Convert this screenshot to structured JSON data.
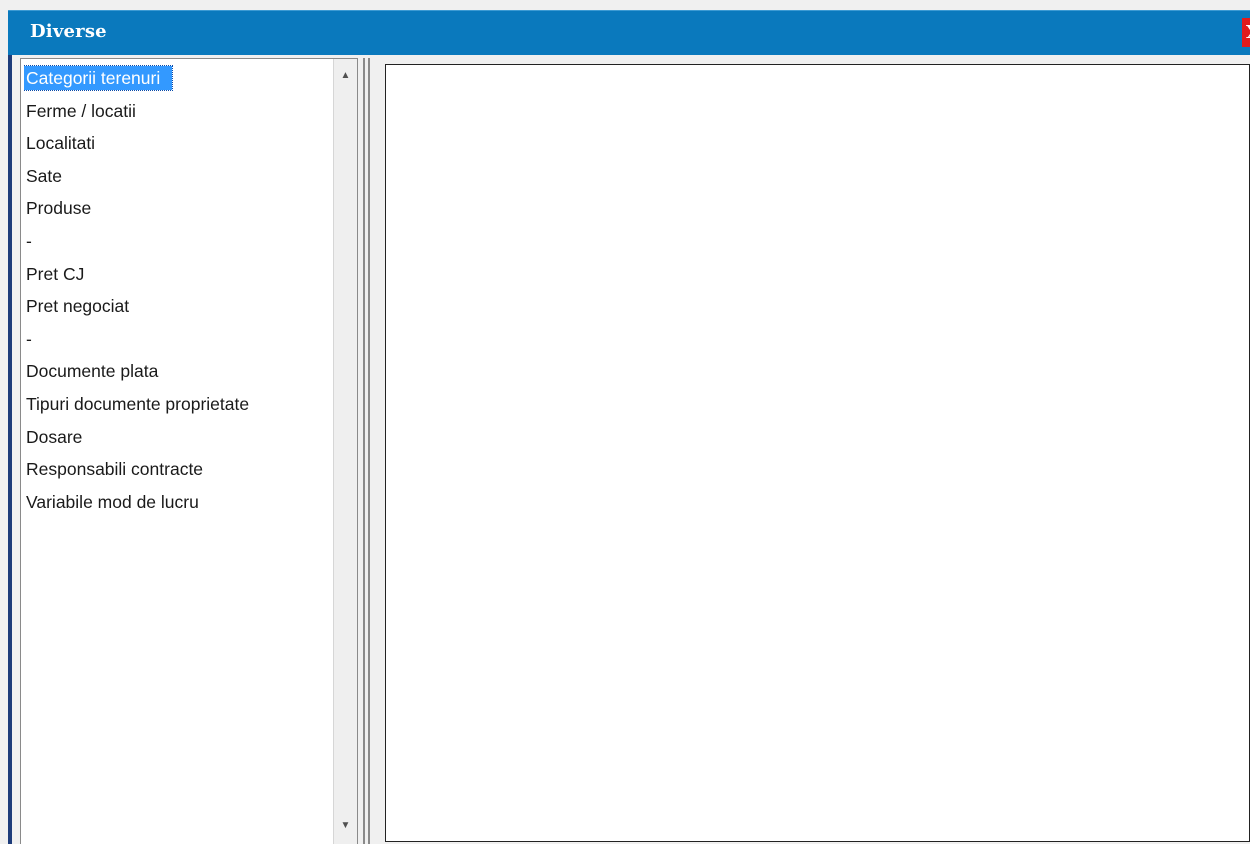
{
  "window": {
    "title": "Diverse",
    "close_label": "X",
    "accent_color": "#0a79bd",
    "close_color": "#e21b1b"
  },
  "list": {
    "selected_index": 0,
    "items": [
      {
        "label": "Categorii terenuri"
      },
      {
        "label": "Ferme / locatii"
      },
      {
        "label": "Localitati"
      },
      {
        "label": "Sate"
      },
      {
        "label": "Produse"
      },
      {
        "label": "-"
      },
      {
        "label": "Pret CJ"
      },
      {
        "label": "Pret negociat"
      },
      {
        "label": "-"
      },
      {
        "label": "Documente plata"
      },
      {
        "label": "Tipuri documente proprietate"
      },
      {
        "label": "Dosare"
      },
      {
        "label": "Responsabili contracte"
      },
      {
        "label": "Variabile mod de lucru"
      }
    ]
  },
  "scrollbar": {
    "up_icon": "scroll-up-arrow",
    "down_icon": "scroll-down-arrow"
  }
}
